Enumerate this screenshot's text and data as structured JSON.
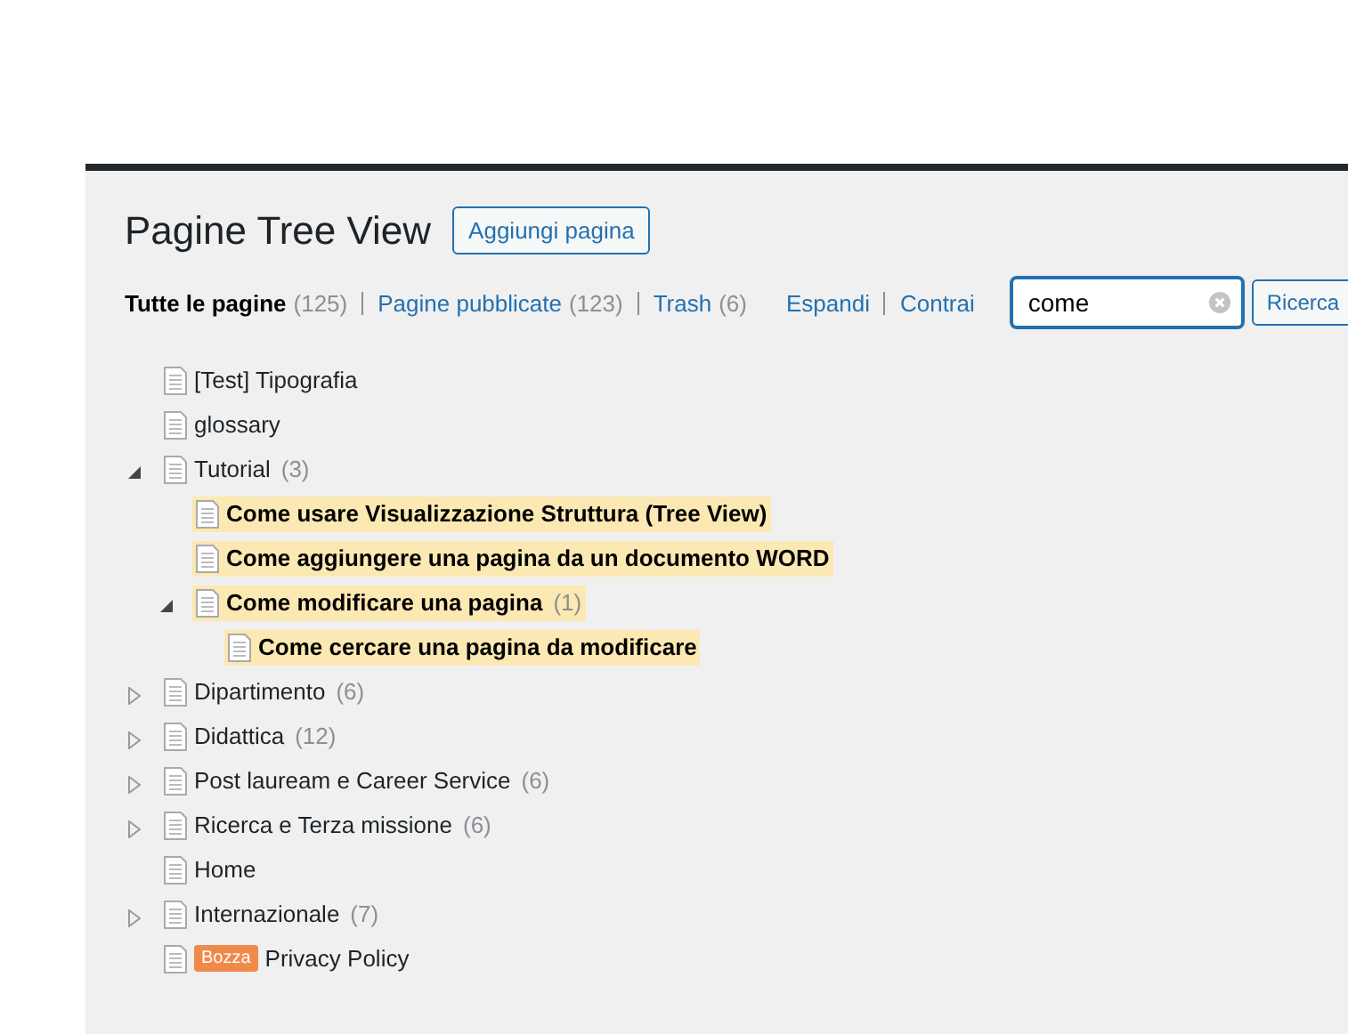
{
  "page_title": "Pagine Tree View",
  "add_button": "Aggiungi pagina",
  "filters": [
    {
      "label": "Tutte le pagine",
      "count": "(125)",
      "selected": true
    },
    {
      "label": "Pagine pubblicate",
      "count": "(123)",
      "selected": false
    },
    {
      "label": "Trash",
      "count": "(6)",
      "selected": false
    }
  ],
  "tree_actions": [
    "Espandi",
    "Contrai"
  ],
  "search": {
    "value": "come",
    "button": "Ricerca"
  },
  "tree": [
    {
      "label": "[Test] Tipografia",
      "match": false
    },
    {
      "label": "glossary",
      "match": false
    },
    {
      "label": "Tutorial",
      "count": "(3)",
      "match": false,
      "expanded": true,
      "children": [
        {
          "label": "Come usare Visualizzazione Struttura (Tree View)",
          "match": true
        },
        {
          "label": "Come aggiungere una pagina da un documento WORD",
          "match": true
        },
        {
          "label": "Come modificare una pagina",
          "count": "(1)",
          "match": true,
          "expanded": true,
          "children": [
            {
              "label": "Come cercare una pagina da modificare",
              "match": true
            }
          ]
        }
      ]
    },
    {
      "label": "Dipartimento",
      "count": "(6)",
      "match": false,
      "expanded": false
    },
    {
      "label": "Didattica",
      "count": "(12)",
      "match": false,
      "expanded": false
    },
    {
      "label": "Post lauream e Career Service",
      "count": "(6)",
      "match": false,
      "expanded": false
    },
    {
      "label": "Ricerca e Terza missione",
      "count": "(6)",
      "match": false,
      "expanded": false
    },
    {
      "label": "Home",
      "match": false
    },
    {
      "label": "Internazionale",
      "count": "(7)",
      "match": false,
      "expanded": false
    },
    {
      "label": "Privacy Policy",
      "badge": "Bozza",
      "match": false
    }
  ]
}
